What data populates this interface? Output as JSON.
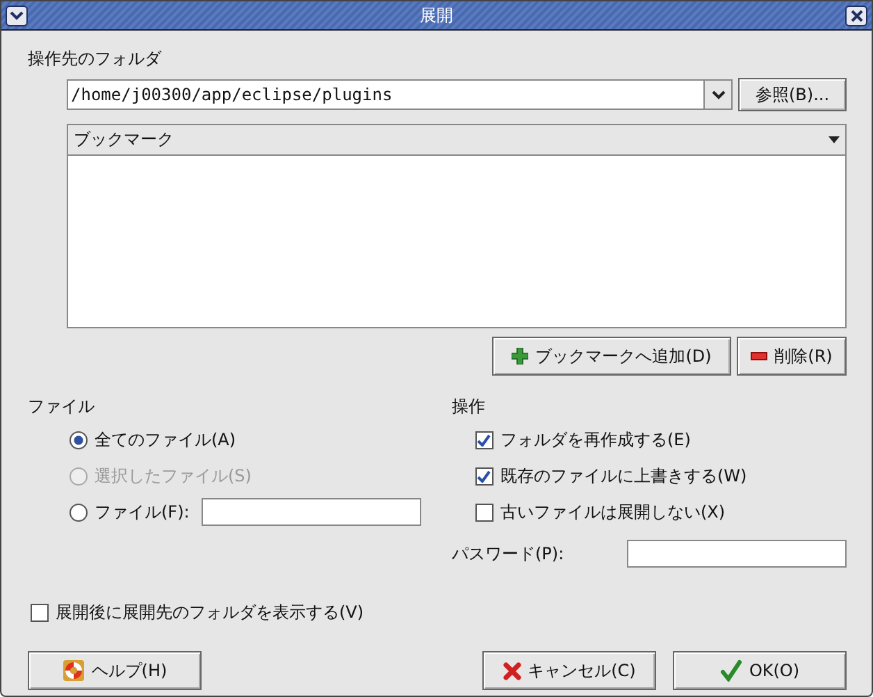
{
  "window": {
    "title": "展開"
  },
  "target_folder": {
    "label": "操作先のフォルダ",
    "path": "/home/j00300/app/eclipse/plugins",
    "browse_button": "参照(B)..."
  },
  "bookmarks": {
    "header": "ブックマーク",
    "add_button": "ブックマークへ追加(D)",
    "delete_button": "削除(R)"
  },
  "files": {
    "label": "ファイル",
    "options": [
      {
        "label": "全てのファイル(A)",
        "selected": true,
        "disabled": false,
        "kind": "plain"
      },
      {
        "label": "選択したファイル(S)",
        "selected": false,
        "disabled": true,
        "kind": "plain"
      },
      {
        "label": "ファイル(F):",
        "selected": false,
        "disabled": false,
        "kind": "field"
      }
    ]
  },
  "operations": {
    "label": "操作",
    "options": [
      {
        "label": "フォルダを再作成する(E)",
        "checked": true
      },
      {
        "label": "既存のファイルに上書きする(W)",
        "checked": true
      },
      {
        "label": "古いファイルは展開しない(X)",
        "checked": false
      }
    ],
    "password_label": "パスワード(P):"
  },
  "show_folder": {
    "label": "展開後に展開先のフォルダを表示する(V)",
    "checked": false
  },
  "buttons": {
    "help": "ヘルプ(H)",
    "cancel": "キャンセル(C)",
    "ok": "OK(O)"
  }
}
